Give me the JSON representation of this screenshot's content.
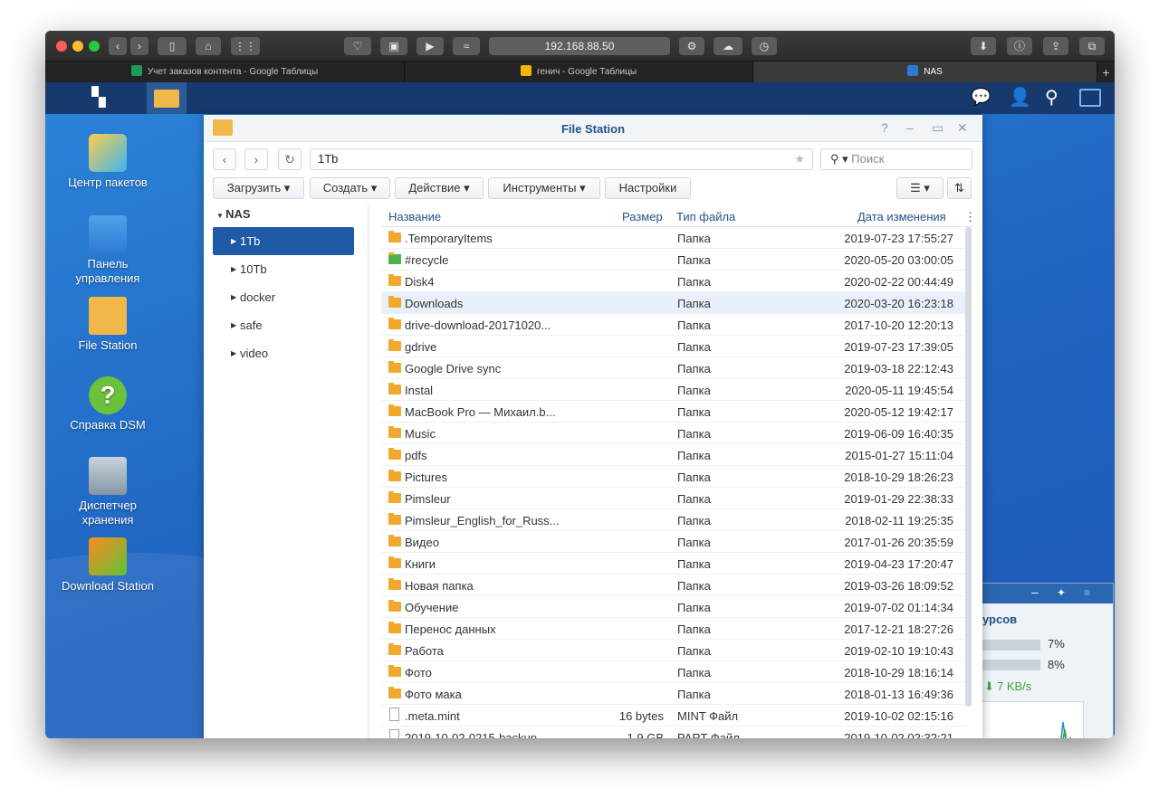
{
  "browser": {
    "address": "192.168.88.50",
    "tabs": [
      {
        "label": "Учет заказов контента - Google Таблицы",
        "color": "#1e9d58"
      },
      {
        "label": "генич - Google Таблицы",
        "color": "#f4b400"
      },
      {
        "label": "NAS",
        "color": "#2d7ad6"
      }
    ]
  },
  "desktop": {
    "icons": [
      {
        "label": "Центр пакетов",
        "icon": "package-center-icon"
      },
      {
        "label": "Панель управления",
        "icon": "control-panel-icon"
      },
      {
        "label": "File Station",
        "icon": "file-station-icon"
      },
      {
        "label": "Справка DSM",
        "icon": "help-icon"
      },
      {
        "label": "Диспетчер хранения",
        "icon": "storage-manager-icon"
      },
      {
        "label": "Download Station",
        "icon": "download-station-icon"
      }
    ]
  },
  "widget": {
    "title": "урсов",
    "cpu": "7%",
    "ram": "8%",
    "net": "7 KB/s"
  },
  "fs": {
    "title": "File Station",
    "path": "1Tb",
    "search_placeholder": "Поиск",
    "buttons": {
      "upload": "Загрузить",
      "create": "Создать",
      "action": "Действие",
      "tools": "Инструменты",
      "settings": "Настройки"
    },
    "tree": {
      "root": "NAS",
      "items": [
        "1Tb",
        "10Tb",
        "docker",
        "safe",
        "video"
      ]
    },
    "columns": {
      "name": "Название",
      "size": "Размер",
      "type": "Тип файла",
      "date": "Дата изменения"
    },
    "rows": [
      {
        "name": ".TemporaryItems",
        "size": "",
        "type": "Папка",
        "date": "2019-07-23 17:55:27",
        "kind": "folder"
      },
      {
        "name": "#recycle",
        "size": "",
        "type": "Папка",
        "date": "2020-05-20 03:00:05",
        "kind": "recycle"
      },
      {
        "name": "Disk4",
        "size": "",
        "type": "Папка",
        "date": "2020-02-22 00:44:49",
        "kind": "folder"
      },
      {
        "name": "Downloads",
        "size": "",
        "type": "Папка",
        "date": "2020-03-20 16:23:18",
        "kind": "folder"
      },
      {
        "name": "drive-download-20171020...",
        "size": "",
        "type": "Папка",
        "date": "2017-10-20 12:20:13",
        "kind": "folder"
      },
      {
        "name": "gdrive",
        "size": "",
        "type": "Папка",
        "date": "2019-07-23 17:39:05",
        "kind": "folder"
      },
      {
        "name": "Google Drive sync",
        "size": "",
        "type": "Папка",
        "date": "2019-03-18 22:12:43",
        "kind": "folder"
      },
      {
        "name": "Instal",
        "size": "",
        "type": "Папка",
        "date": "2020-05-11 19:45:54",
        "kind": "folder"
      },
      {
        "name": "MacBook Pro — Михаил.b...",
        "size": "",
        "type": "Папка",
        "date": "2020-05-12 19:42:17",
        "kind": "folder"
      },
      {
        "name": "Music",
        "size": "",
        "type": "Папка",
        "date": "2019-06-09 16:40:35",
        "kind": "folder"
      },
      {
        "name": "pdfs",
        "size": "",
        "type": "Папка",
        "date": "2015-01-27 15:11:04",
        "kind": "folder"
      },
      {
        "name": "Pictures",
        "size": "",
        "type": "Папка",
        "date": "2018-10-29 18:26:23",
        "kind": "folder"
      },
      {
        "name": "Pimsleur",
        "size": "",
        "type": "Папка",
        "date": "2019-01-29 22:38:33",
        "kind": "folder"
      },
      {
        "name": "Pimsleur_English_for_Russ...",
        "size": "",
        "type": "Папка",
        "date": "2018-02-11 19:25:35",
        "kind": "folder"
      },
      {
        "name": "Видео",
        "size": "",
        "type": "Папка",
        "date": "2017-01-26 20:35:59",
        "kind": "folder"
      },
      {
        "name": "Книги",
        "size": "",
        "type": "Папка",
        "date": "2019-04-23 17:20:47",
        "kind": "folder"
      },
      {
        "name": "Новая папка",
        "size": "",
        "type": "Папка",
        "date": "2019-03-26 18:09:52",
        "kind": "folder"
      },
      {
        "name": "Обучение",
        "size": "",
        "type": "Папка",
        "date": "2019-07-02 01:14:34",
        "kind": "folder"
      },
      {
        "name": "Перенос данных",
        "size": "",
        "type": "Папка",
        "date": "2017-12-21 18:27:26",
        "kind": "folder"
      },
      {
        "name": "Работа",
        "size": "",
        "type": "Папка",
        "date": "2019-02-10 19:10:43",
        "kind": "folder"
      },
      {
        "name": "Фото",
        "size": "",
        "type": "Папка",
        "date": "2018-10-29 18:16:14",
        "kind": "folder"
      },
      {
        "name": "Фото мака",
        "size": "",
        "type": "Папка",
        "date": "2018-01-13 16:49:36",
        "kind": "folder"
      },
      {
        "name": ".meta.mint",
        "size": "16 bytes",
        "type": "MINT Файл",
        "date": "2019-10-02 02:15:16",
        "kind": "file"
      },
      {
        "name": "2019-10-02-0215-backup...",
        "size": "1.9 GB",
        "type": "PART Файл",
        "date": "2019-10-02 02:32:21",
        "kind": "file"
      }
    ],
    "highlighted_row": 3
  }
}
